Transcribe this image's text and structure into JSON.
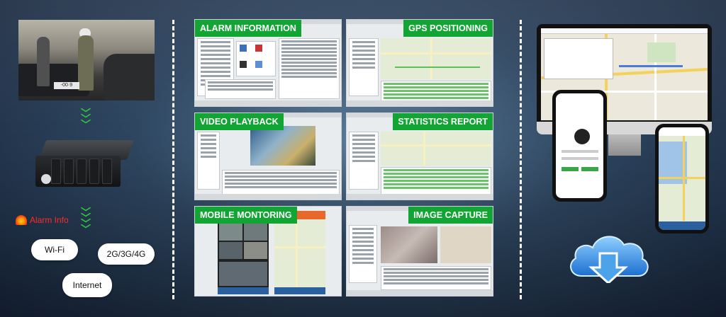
{
  "left": {
    "alarm_label": "Alarm Info",
    "network_labels": [
      "Wi-Fi",
      "2G/3G/4G",
      "Internet"
    ],
    "plate_text": "-00·9"
  },
  "panels": [
    {
      "caption": "ALARM INFORMATION"
    },
    {
      "caption": "GPS POSITIONING"
    },
    {
      "caption": "VIDEO PLAYBACK"
    },
    {
      "caption": "STATISTICS REPORT"
    },
    {
      "caption": "MOBILE MONTORING"
    },
    {
      "caption": "IMAGE CAPTURE"
    }
  ],
  "colors": {
    "caption_green": "#12a534",
    "divider": "#ffffff",
    "alarm_red": "#ff2a2a",
    "chevron_green": "#2ecc40",
    "cloud_blue": "#3a8fe0"
  },
  "icons": [
    "chevron-down-icon",
    "alarm-light-icon",
    "download-cloud-icon"
  ]
}
